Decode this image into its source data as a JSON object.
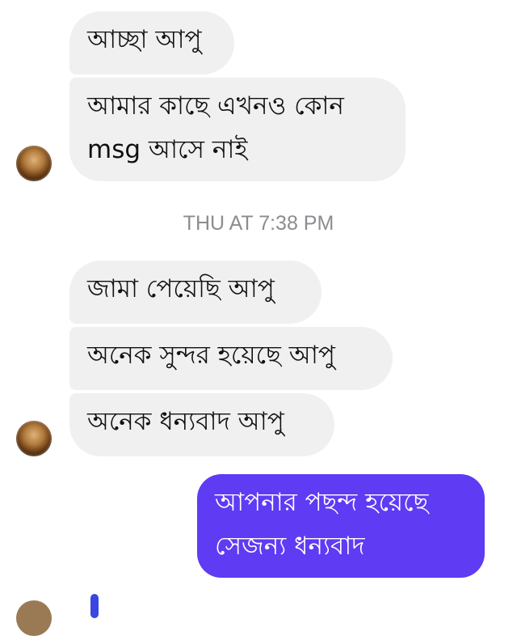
{
  "messages": [
    {
      "text": "আচ্ছা আপু"
    },
    {
      "line1": "আমার কাছে এখনও কোন",
      "line2": "msg আসে নাই"
    },
    {
      "text": "জামা পেয়েছি আপু"
    },
    {
      "text": "অনেক সুন্দর হয়েছে আপু"
    },
    {
      "text": "অনেক ধন্যবাদ আপু"
    },
    {
      "line1": "আপনার পছন্দ হয়েছে",
      "line2": "সেজন্য ধন্যবাদ"
    }
  ],
  "timestamp": "THU AT 7:38 PM",
  "colors": {
    "incoming_bubble": "#f1f0f0",
    "outgoing_bubble": "#5f3bf3",
    "timestamp": "#8a8d91"
  }
}
